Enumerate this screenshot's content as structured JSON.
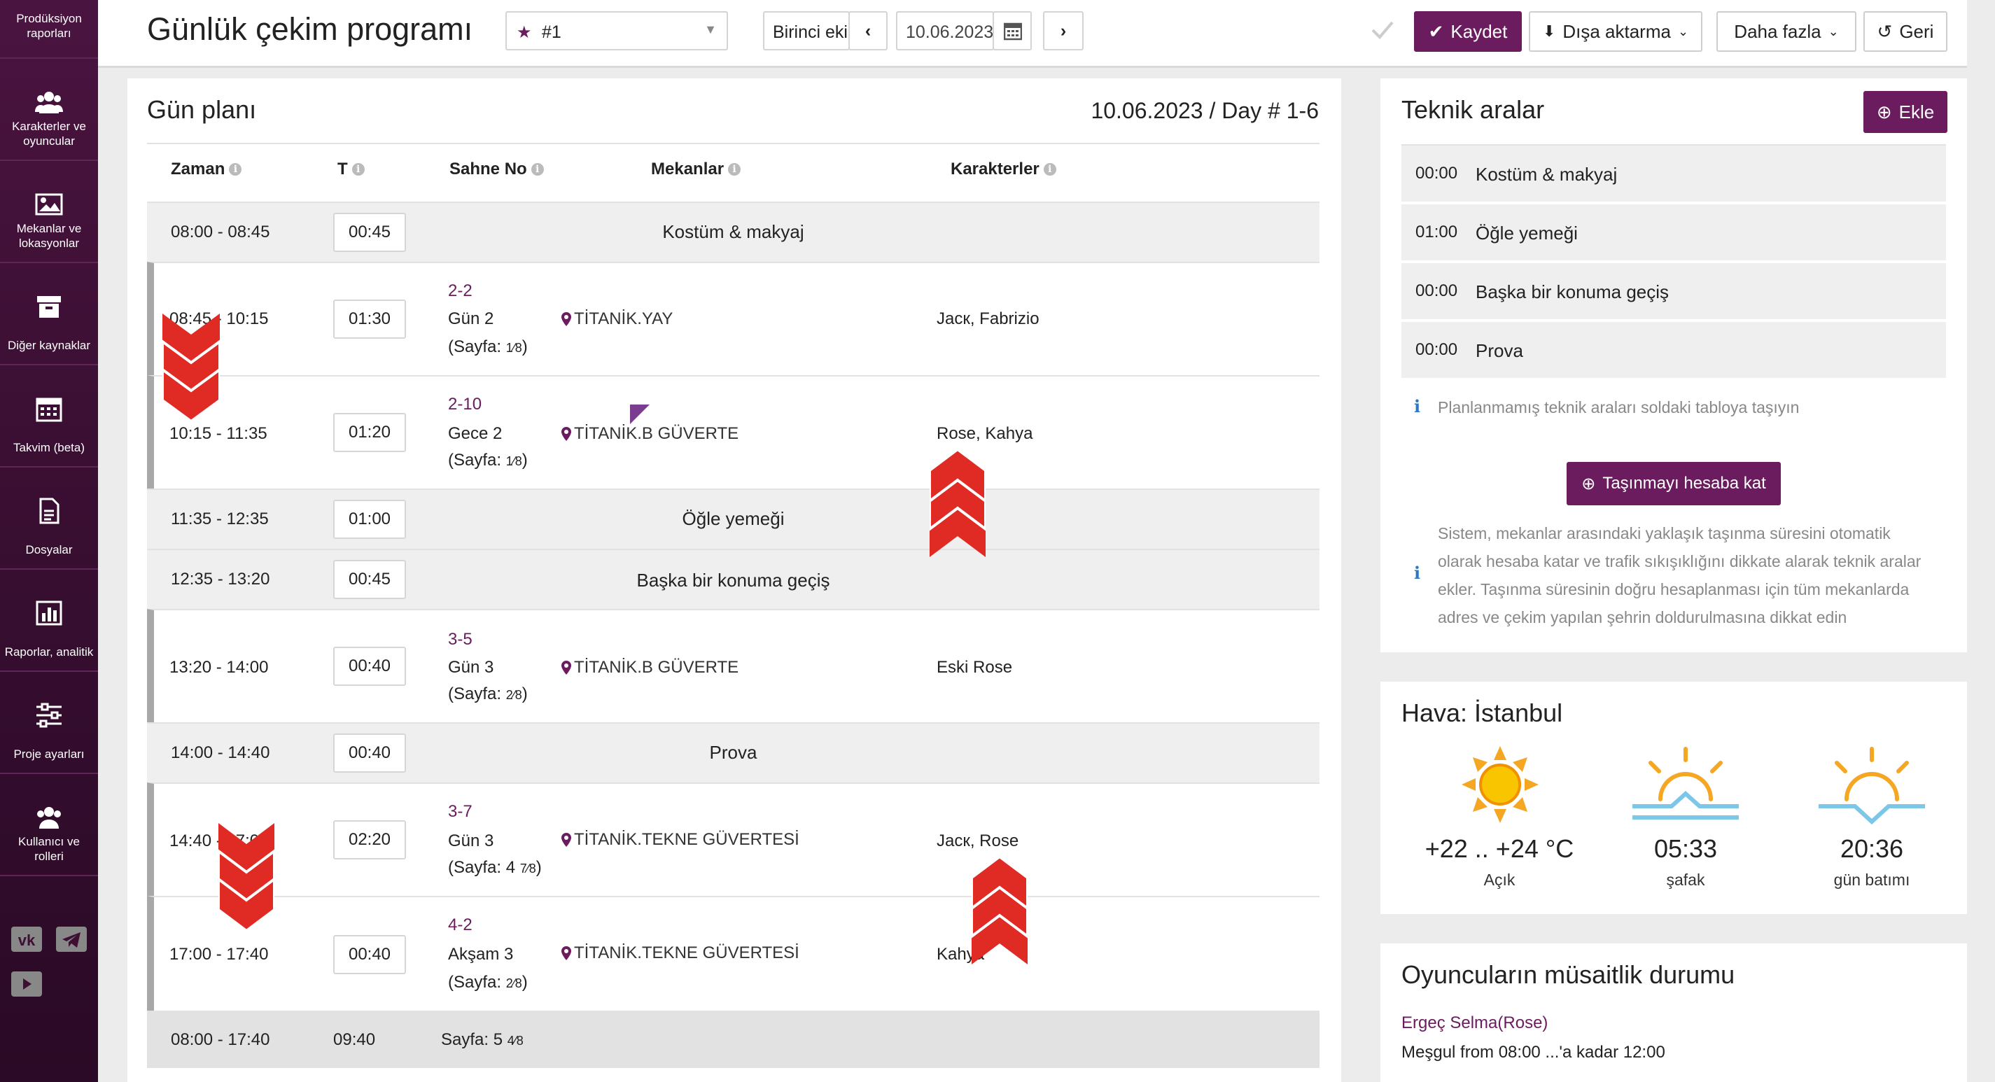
{
  "sidebar": {
    "items": [
      {
        "label": "Prodüksiyon raporları",
        "icon": "report-icon"
      },
      {
        "label": "Karakterler ve oyuncular",
        "icon": "users-icon"
      },
      {
        "label": "Mekanlar ve lokasyonlar",
        "icon": "image-icon"
      },
      {
        "label": "Diğer kaynaklar",
        "icon": "archive-icon"
      },
      {
        "label": "Takvim (beta)",
        "icon": "calendar-icon"
      },
      {
        "label": "Dosyalar",
        "icon": "file-icon"
      },
      {
        "label": "Raporlar, analitik",
        "icon": "chart-icon"
      },
      {
        "label": "Proje ayarları",
        "icon": "sliders-icon"
      },
      {
        "label": "Kullanıcı ve rolleri",
        "icon": "users-icon"
      }
    ],
    "social": [
      "vk-icon",
      "telegram-icon",
      "youtube-icon"
    ]
  },
  "header": {
    "title": "Günlük çekim programı",
    "schedule_select": "#1",
    "unit_select": "Birinci ekip",
    "date": "10.06.2023",
    "save_label": "Kaydet",
    "export_label": "Dışa aktarma",
    "more_label": "Daha fazla",
    "back_label": "Geri"
  },
  "plan": {
    "title": "Gün planı",
    "date_day": "10.06.2023 / Day # 1-6",
    "columns": {
      "time": "Zaman",
      "t": "T",
      "scene": "Sahne No",
      "locations": "Mekanlar",
      "characters": "Karakterler"
    },
    "rows": [
      {
        "kind": "break",
        "time": "08:00 - 08:45",
        "dur": "00:45",
        "label": "Kostüm & makyaj"
      },
      {
        "kind": "scene",
        "time": "08:45 - 10:15",
        "dur": "01:30",
        "no": "2-2",
        "desc": "Gün 2",
        "page_pre": "(Sayfa: ",
        "page_frac": "1⁄8",
        "page_post": ")",
        "loc": "TİTANİK.YAY",
        "chars": "Jacк, Fabrizio"
      },
      {
        "kind": "scene",
        "time": "10:15 - 11:35",
        "dur": "01:20",
        "no": "2-10",
        "desc": "Gece 2",
        "page_pre": "(Sayfa: ",
        "page_frac": "1⁄8",
        "page_post": ")",
        "loc": "TİTANİK.B GÜVERTE",
        "chars": "Rose, Kahya"
      },
      {
        "kind": "break",
        "time": "11:35 - 12:35",
        "dur": "01:00",
        "label": "Öğle yemeği"
      },
      {
        "kind": "break",
        "time": "12:35 - 13:20",
        "dur": "00:45",
        "label": "Başka bir konuma geçiş"
      },
      {
        "kind": "scene",
        "time": "13:20 - 14:00",
        "dur": "00:40",
        "no": "3-5",
        "desc": "Gün 3",
        "page_pre": "(Sayfa: ",
        "page_frac": "2⁄8",
        "page_post": ")",
        "loc": "TİTANİK.B GÜVERTE",
        "chars": "Eski Rose"
      },
      {
        "kind": "break",
        "time": "14:00 - 14:40",
        "dur": "00:40",
        "label": "Prova"
      },
      {
        "kind": "scene",
        "time": "14:40 - 17:00",
        "dur": "02:20",
        "no": "3-7",
        "desc": "Gün 3",
        "page_pre": "(Sayfa: 4 ",
        "page_frac": "7⁄8",
        "page_post": ")",
        "loc": "TİTANİK.TEKNE GÜVERTESİ",
        "chars": "Jacк, Rose"
      },
      {
        "kind": "scene",
        "time": "17:00 - 17:40",
        "dur": "00:40",
        "no": "4-2",
        "desc": "Akşam 3",
        "page_pre": "(Sayfa: ",
        "page_frac": "2⁄8",
        "page_post": ")",
        "loc": "TİTANİK.TEKNE GÜVERTESİ",
        "chars": "Kahya"
      }
    ],
    "total": {
      "time": "08:00 - 17:40",
      "dur": "09:40",
      "pages": "Sayfa: 5 ",
      "pages_frac": "4⁄8"
    }
  },
  "tech": {
    "title": "Teknik aralar",
    "add_label": "Ekle",
    "items": [
      {
        "time": "00:00",
        "name": "Kostüm & makyaj"
      },
      {
        "time": "01:00",
        "name": "Öğle yemeği"
      },
      {
        "time": "00:00",
        "name": "Başka bir konuma geçiş"
      },
      {
        "time": "00:00",
        "name": "Prova"
      }
    ],
    "hint": "Planlanmamış teknik araları soldaki tabloya taşıyın",
    "calc_btn": "Taşınmayı hesaba kat",
    "desc_lines": [
      "Sistem, mekanlar arasındaki yaklaşık taşınma süresini otomatik",
      "olarak hesaba katar ve trafik sıkışıklığını dikkate alarak teknik aralar",
      "ekler. Taşınma süresinin doğru hesaplanması için tüm mekanlarda",
      "adres ve çekim yapılan şehrin doldurulmasına dikkat edin"
    ]
  },
  "weather": {
    "title": "Hava: İstanbul",
    "temp": "+22 .. +24 °C",
    "cond": "Açık",
    "sunrise": "05:33",
    "sunrise_lbl": "şafak",
    "sunset": "20:36",
    "sunset_lbl": "gün batımı",
    "colors": {
      "sun": "#f5a623",
      "sea": "#7cc7e8"
    }
  },
  "availability": {
    "title": "Oyuncuların müsaitlik durumu",
    "actor": "Ergeç Selma(Rose)",
    "busy": "Meşgul from 08:00 ...'a kadar 12:00"
  },
  "colors": {
    "accent": "#6b1c5f",
    "sidebar": "#3d1033",
    "arrow": "#e02a24"
  }
}
